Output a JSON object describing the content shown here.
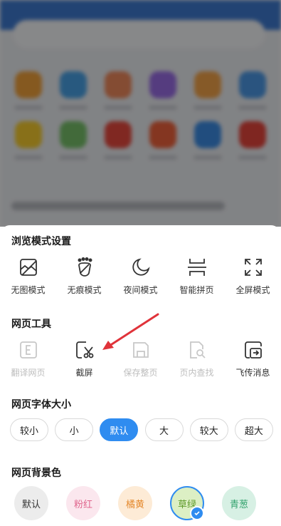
{
  "sections": {
    "browse_mode_title": "浏览模式设置",
    "web_tools_title": "网页工具",
    "font_size_title": "网页字体大小",
    "background_title": "网页背景色"
  },
  "browse_modes": [
    {
      "label": "无图模式",
      "icon": "no-image-icon"
    },
    {
      "label": "无痕模式",
      "icon": "footprint-icon"
    },
    {
      "label": "夜间模式",
      "icon": "moon-icon"
    },
    {
      "label": "智能拼页",
      "icon": "page-join-icon"
    },
    {
      "label": "全屏模式",
      "icon": "fullscreen-icon"
    }
  ],
  "web_tools": [
    {
      "label": "翻译网页",
      "icon": "translate-icon",
      "enabled": false
    },
    {
      "label": "截屏",
      "icon": "screenshot-icon",
      "enabled": true
    },
    {
      "label": "保存整页",
      "icon": "save-page-icon",
      "enabled": false
    },
    {
      "label": "页内查找",
      "icon": "find-in-page-icon",
      "enabled": false
    },
    {
      "label": "飞传消息",
      "icon": "send-message-icon",
      "enabled": true
    }
  ],
  "font_sizes": [
    "较小",
    "小",
    "默认",
    "大",
    "较大",
    "超大"
  ],
  "font_size_selected": "默认",
  "background_colors": [
    {
      "label": "默认",
      "color": "#ececec",
      "text_color": "#333333"
    },
    {
      "label": "粉红",
      "color": "#fbe7ee",
      "text_color": "#e0668e"
    },
    {
      "label": "橘黄",
      "color": "#fdebd6",
      "text_color": "#e58a2e"
    },
    {
      "label": "草绿",
      "color": "#dcefc4",
      "text_color": "#5e9a2a",
      "selected": true
    },
    {
      "label": "青葱",
      "color": "#d7f0e4",
      "text_color": "#34a36e"
    }
  ],
  "colors": {
    "accent": "#2f8cf0",
    "annotation_arrow": "#e0333a"
  }
}
